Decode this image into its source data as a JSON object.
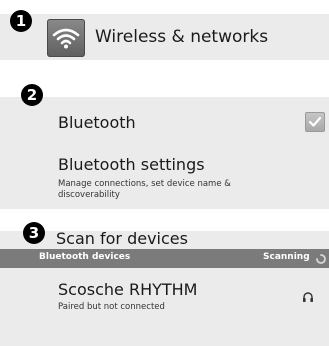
{
  "wireless": {
    "step": "1",
    "title": "Wireless & networks",
    "icon": "wifi-icon"
  },
  "bluetooth": {
    "step": "2",
    "toggle_label": "Bluetooth",
    "toggle_checked": true,
    "settings_title": "Bluetooth settings",
    "settings_summary_line1": "Manage connections, set device name &",
    "settings_summary_line2": "discoverability"
  },
  "scan": {
    "step": "3",
    "label": "Scan for devices"
  },
  "devices": {
    "header": "Bluetooth devices",
    "status": "Scanning",
    "items": [
      {
        "name": "Scosche RHYTHM",
        "status": "Paired but not connected",
        "icon": "headphones-icon"
      }
    ]
  },
  "colors": {
    "panel_bg": "#ebebeb",
    "header_bar": "#7b7b7b",
    "badge": "#000000"
  }
}
